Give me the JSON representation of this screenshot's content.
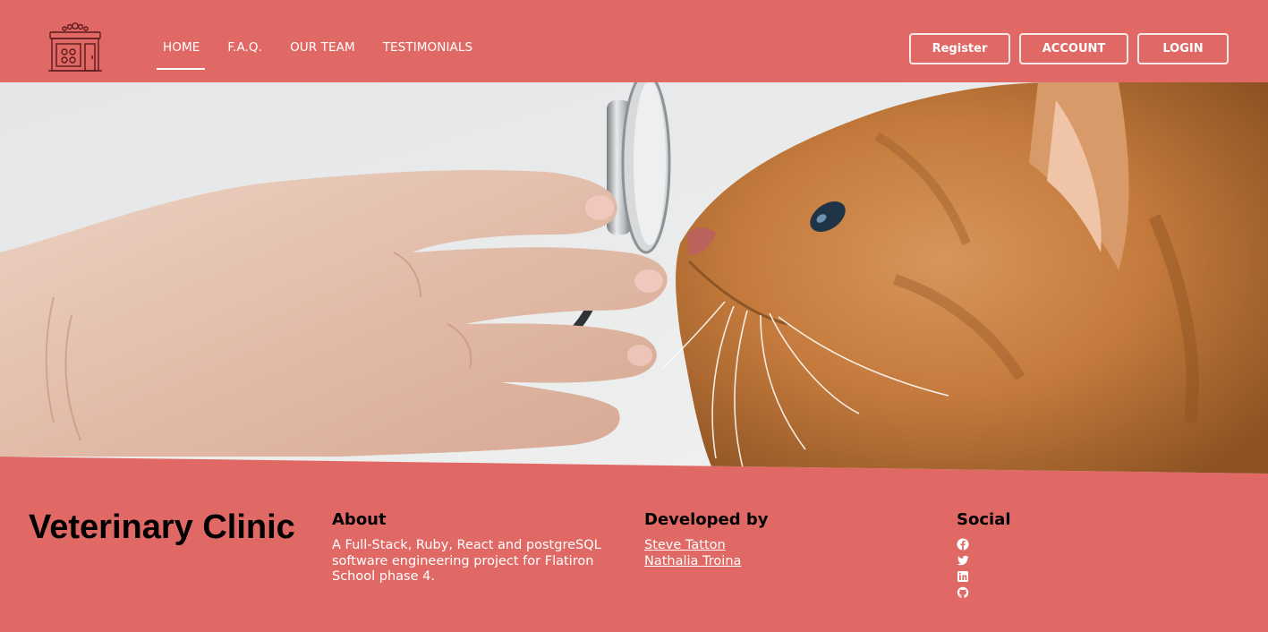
{
  "nav": {
    "items": [
      {
        "label": "HOME",
        "active": true
      },
      {
        "label": "F.A.Q.",
        "active": false
      },
      {
        "label": "OUR TEAM",
        "active": false
      },
      {
        "label": "TESTIMONIALS",
        "active": false
      }
    ]
  },
  "auth": {
    "register_label": "Register",
    "account_label": "ACCOUNT",
    "login_label": "LOGIN"
  },
  "footer": {
    "brand": "Veterinary Clinic",
    "about": {
      "heading": "About",
      "text": "A Full-Stack, Ruby, React and postgreSQL software engineering project for Flatiron School phase 4."
    },
    "developed_by": {
      "heading": "Developed by",
      "developers": [
        "Steve Tatton",
        "Nathalia Troina"
      ]
    },
    "social": {
      "heading": "Social",
      "icons": [
        "facebook-icon",
        "twitter-icon",
        "linkedin-icon",
        "github-icon"
      ]
    }
  },
  "colors": {
    "brand": "#e16965",
    "text_light": "#ffffff",
    "text_dark": "#000000"
  }
}
